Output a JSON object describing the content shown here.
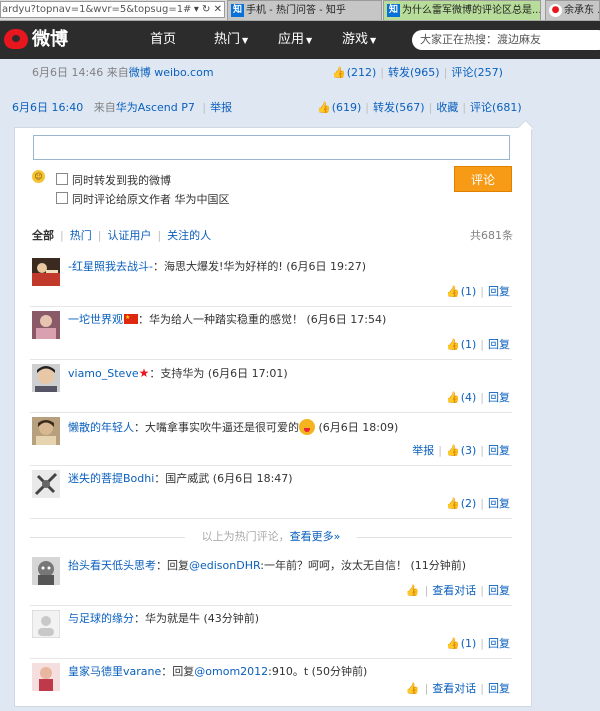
{
  "browser": {
    "url": "ardyu?topnav=1&wvr=5&topsug=1#",
    "tabs": [
      {
        "title": "手机 - 热门问答 - 知乎",
        "icon": "zhihu-icon"
      },
      {
        "title": "为什么雷军微博的评论区总是...",
        "icon": "zhihu-icon"
      },
      {
        "title": "余承东 ...",
        "icon": "weibo-icon"
      }
    ]
  },
  "nav": {
    "logo_text": "微博",
    "items": [
      {
        "label": "首页",
        "dropdown": false
      },
      {
        "label": "热门",
        "dropdown": true
      },
      {
        "label": "应用",
        "dropdown": true
      },
      {
        "label": "游戏",
        "dropdown": true
      }
    ],
    "search_placeholder": "大家正在热搜：渡边麻友"
  },
  "repost": {
    "time": "6月6日 14:46",
    "source_prefix": "来自",
    "source": "微博 weibo.com",
    "likes": "(212)",
    "forward": "转发(965)",
    "comments": "评论(257)"
  },
  "post": {
    "time": "6月6日 16:40",
    "source_prefix": "来自",
    "source": "华为Ascend P7",
    "report": "举报",
    "likes": "(619)",
    "forward": "转发(567)",
    "favorite": "收藏",
    "comments": "评论(681)"
  },
  "composer": {
    "option_forward": "同时转发到我的微博",
    "option_comment_original": "同时评论给原文作者 华为中国区",
    "submit_label": "评论"
  },
  "filter": {
    "tabs": [
      "全部",
      "热门",
      "认证用户",
      "关注的人"
    ],
    "total": "共681条"
  },
  "comments": [
    {
      "user": "-红星照我去战斗-",
      "text": "：海思大爆发!华为好样的! (6月6日 19:27)",
      "report": "",
      "likes": "(1)",
      "view_thread": "",
      "reply": "回复"
    },
    {
      "user": "一坨世界观",
      "text": "：华为给人一种踏实稳重的感觉！ (6月6日 17:54)",
      "report": "",
      "likes": "(1)",
      "view_thread": "",
      "reply": "回复"
    },
    {
      "user": "viamo_Steve",
      "text": "：支持华为 (6月6日 17:01)",
      "report": "",
      "likes": "(4)",
      "view_thread": "",
      "reply": "回复"
    },
    {
      "user": "懒散的年轻人",
      "text": "：大嘴拿事实吹牛逼还是很可爱的",
      "time": " (6月6日 18:09)",
      "report": "举报",
      "likes": "(3)",
      "view_thread": "",
      "reply": "回复"
    },
    {
      "user": "迷失的菩提Bodhi",
      "text": "：国产威武 (6月6日 18:47)",
      "report": "",
      "likes": "(2)",
      "view_thread": "",
      "reply": "回复"
    },
    {
      "user": "抬头看天低头思考",
      "text_prefix": "：回复",
      "mention": "@edisonDHR",
      "text": ":一年前？呵呵，汝太无自信！ (11分钟前)",
      "report": "",
      "likes": "",
      "view_thread": "查看对话",
      "reply": "回复"
    },
    {
      "user": "与足球的缘分",
      "text": "：华为就是牛 (43分钟前)",
      "report": "",
      "likes": "(1)",
      "view_thread": "",
      "reply": "回复"
    },
    {
      "user": "皇家马德里varane",
      "text_prefix": "：回复",
      "mention": "@omom2012",
      "text": ":910。t (50分钟前)",
      "report": "",
      "likes": "",
      "view_thread": "查看对话",
      "reply": "回复"
    }
  ],
  "hot_divider": {
    "text": "以上为热门评论，",
    "more_link": "查看更多»"
  },
  "colors": {
    "nav_bg": "#2c2c2c",
    "link": "#0a5fbd",
    "submit": "#f79b16",
    "logo_red": "#e8171f"
  }
}
